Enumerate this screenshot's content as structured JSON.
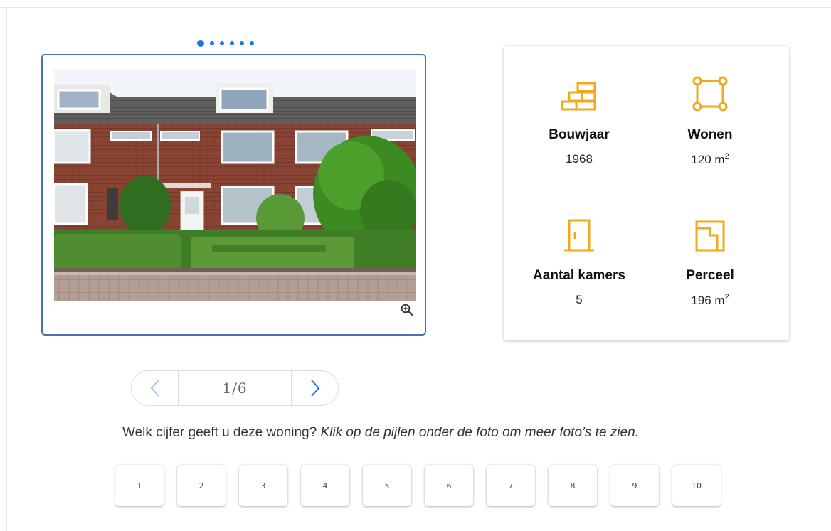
{
  "carousel": {
    "dot_count": 6,
    "active_index": 0,
    "current_page": "1/6"
  },
  "property": {
    "bouwjaar": {
      "label": "Bouwjaar",
      "value": "1968",
      "icon": "bricks-icon"
    },
    "wonen": {
      "label": "Wonen",
      "value": "120 m",
      "unit_sup": "2",
      "icon": "floor-area-icon"
    },
    "kamers": {
      "label": "Aantal kamers",
      "value": "5",
      "icon": "door-icon"
    },
    "perceel": {
      "label": "Perceel",
      "value": "196 m",
      "unit_sup": "2",
      "icon": "plot-icon"
    }
  },
  "question": {
    "text": "Welk cijfer geeft u deze woning? ",
    "hint": "Klik op de pijlen onder de foto om meer foto’s te zien."
  },
  "ratings": [
    "1",
    "2",
    "3",
    "4",
    "5",
    "6",
    "7",
    "8",
    "9",
    "10"
  ],
  "colors": {
    "accent_blue": "#1a73e8",
    "icon_orange": "#f0a81c",
    "card_border": "#4a72b0"
  }
}
